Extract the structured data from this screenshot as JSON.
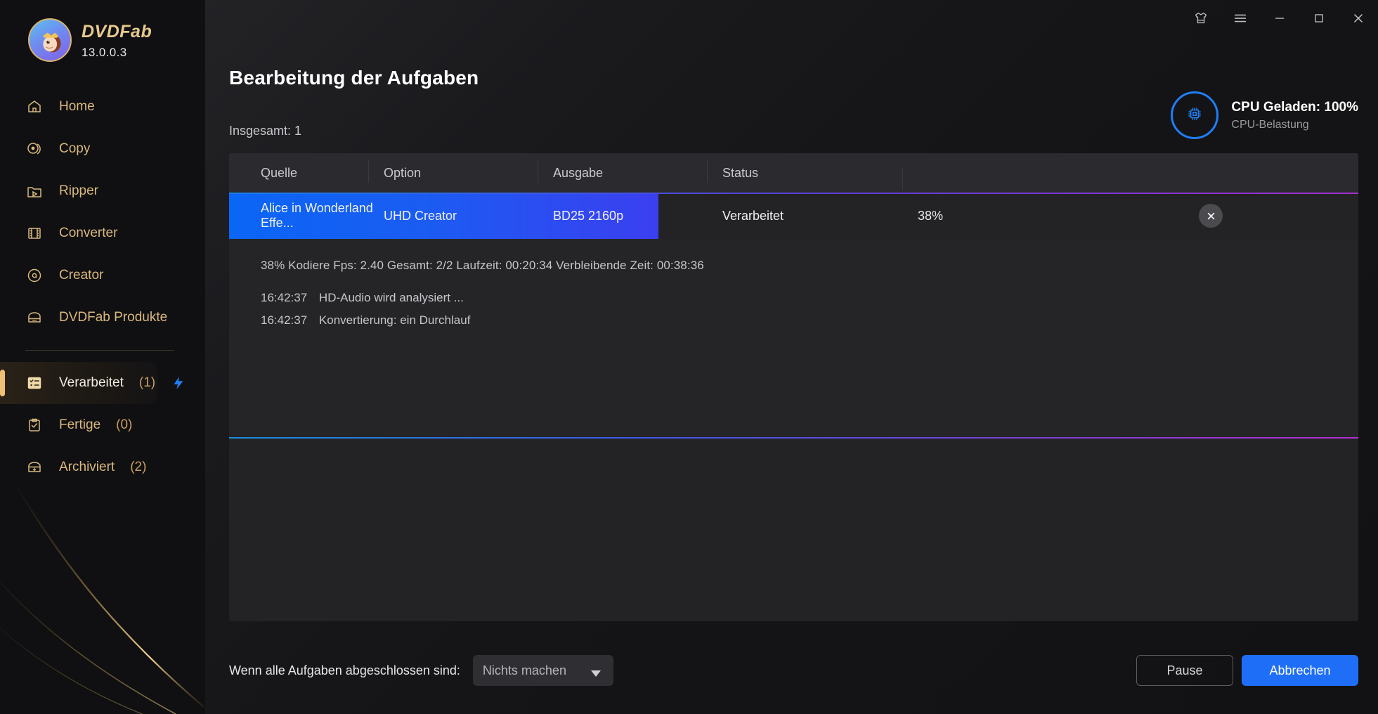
{
  "app": {
    "brand_name": "DVDFab",
    "version": "13.0.0.3"
  },
  "window_controls": {
    "skin": "skin-icon",
    "menu": "hamburger-menu-icon",
    "minimize": "minimize-icon",
    "maximize": "maximize-icon",
    "close": "close-icon"
  },
  "sidebar": {
    "items": [
      {
        "label": "Home",
        "icon": "home-icon",
        "name": "home"
      },
      {
        "label": "Copy",
        "icon": "disc-copy-icon",
        "name": "copy"
      },
      {
        "label": "Ripper",
        "icon": "ripper-icon",
        "name": "ripper"
      },
      {
        "label": "Converter",
        "icon": "film-icon",
        "name": "converter"
      },
      {
        "label": "Creator",
        "icon": "disc-icon",
        "name": "creator"
      },
      {
        "label": "DVDFab Produkte",
        "icon": "box-icon",
        "name": "dvdfab-produkte"
      }
    ],
    "queue_items": [
      {
        "label": "Verarbeitet",
        "count": "(1)",
        "icon": "task-list-icon",
        "name": "verarbeitet",
        "active": true,
        "badge": "lightning-bolt-icon"
      },
      {
        "label": "Fertige",
        "count": "(0)",
        "icon": "clipboard-check-icon",
        "name": "fertige",
        "active": false,
        "badge": ""
      },
      {
        "label": "Archiviert",
        "count": "(2)",
        "icon": "archive-icon",
        "name": "archiviert",
        "active": false,
        "badge": ""
      }
    ]
  },
  "header": {
    "title": "Bearbeitung der Aufgaben",
    "total": "Insgesamt: 1"
  },
  "cpu": {
    "title": "CPU Geladen: 100%",
    "subtitle": "CPU-Belastung",
    "icon": "cpu-chip-icon",
    "accent": "#1f7ef5"
  },
  "table": {
    "columns": [
      "Quelle",
      "Option",
      "Ausgabe",
      "Status"
    ],
    "row": {
      "source": "Alice in Wonderland  Effe...",
      "option": "UHD Creator",
      "output": "BD25 2160p",
      "status": "Verarbeitet",
      "progress": "38%",
      "progress_value": 38,
      "close_icon": "close-icon"
    },
    "detail": {
      "stats": "38%  Kodiere Fps: 2.40   Gesamt: 2/2  Laufzeit: 00:20:34  Verbleibende Zeit: 00:38:36",
      "log": [
        {
          "time": "16:42:37",
          "text": "HD-Audio wird analysiert ..."
        },
        {
          "time": "16:42:37",
          "text": "Konvertierung: ein Durchlauf"
        }
      ]
    }
  },
  "footer": {
    "label": "Wenn alle Aufgaben abgeschlossen sind:",
    "select_value": "Nichts machen",
    "select_arrow": "chevron-down-icon",
    "pause_label": "Pause",
    "cancel_label": "Abbrechen"
  },
  "colors": {
    "accent_blue": "#1f6ef7",
    "accent_gold": "#e8c98d",
    "panel_bg": "#232326",
    "sidebar_bg": "#101012"
  }
}
